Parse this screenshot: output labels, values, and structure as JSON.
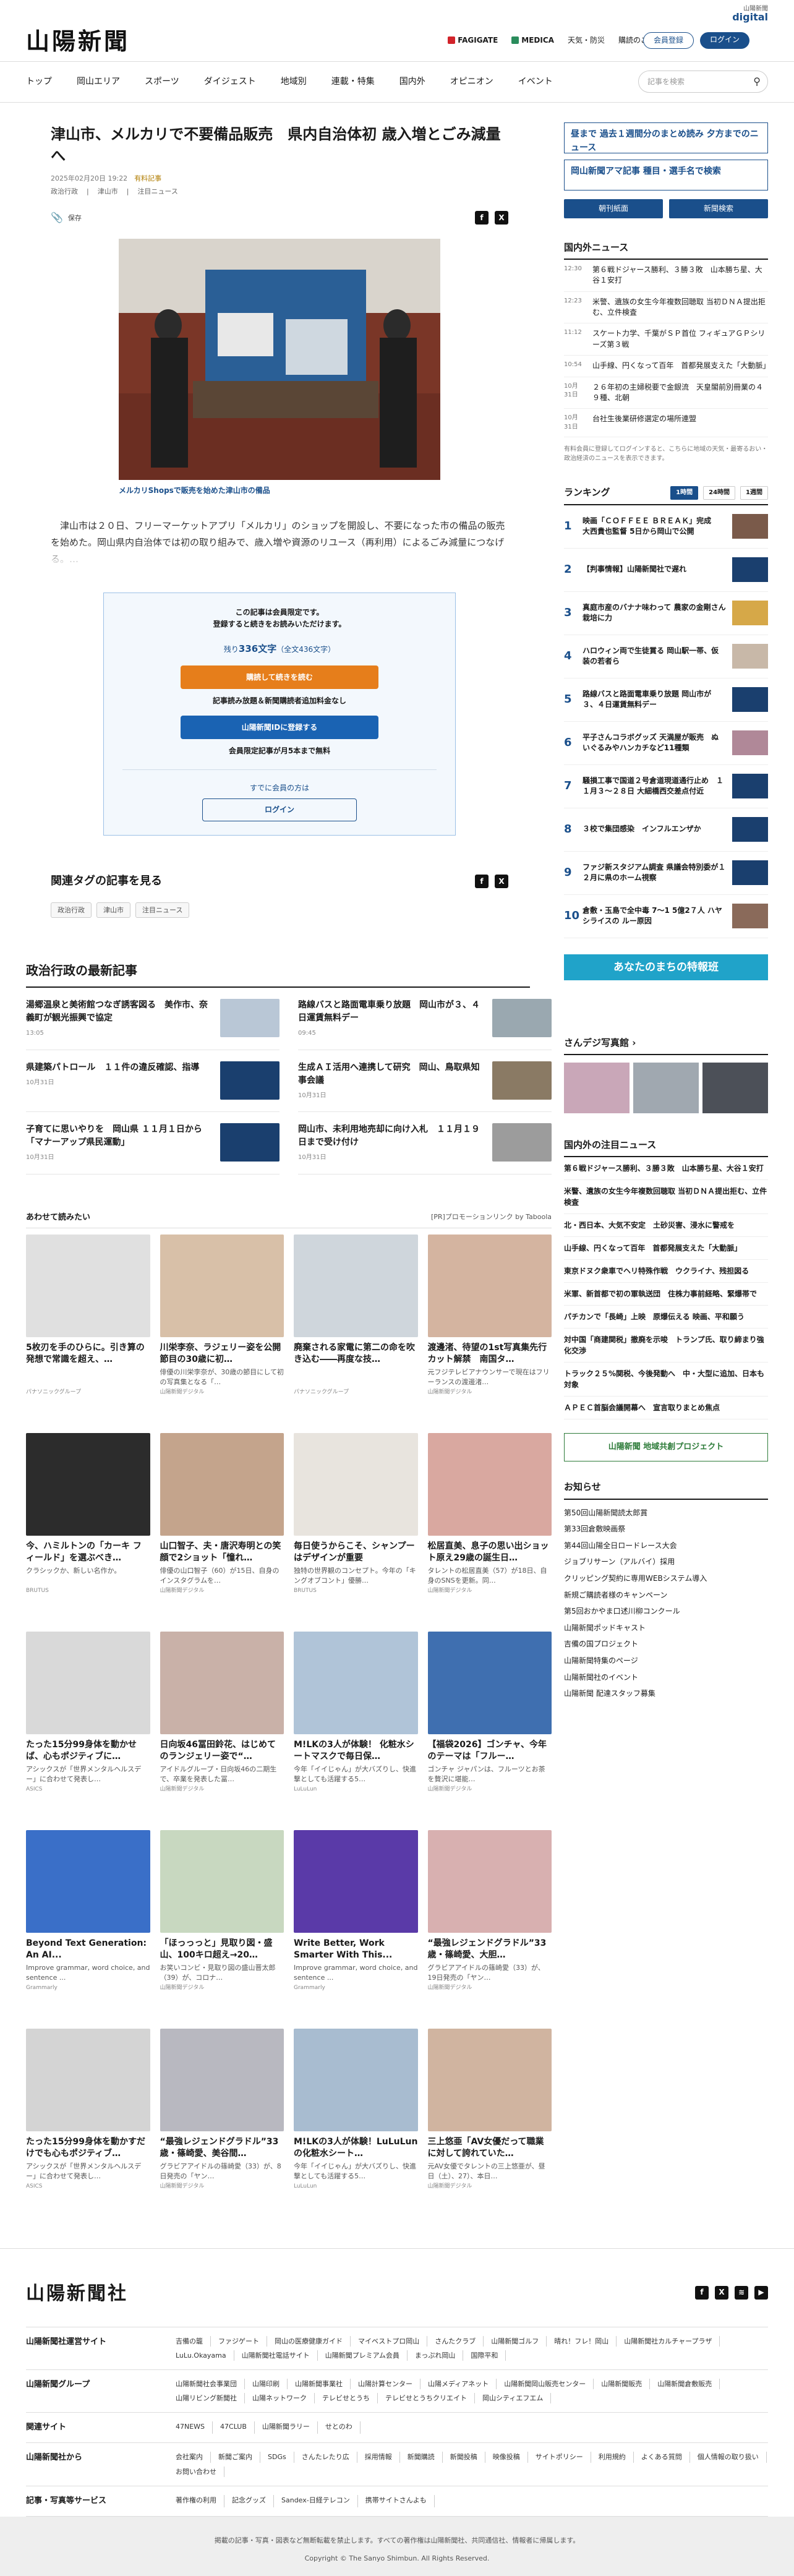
{
  "header": {
    "logo": "山陽新聞",
    "links": [
      "FAGIGATE",
      "MEDICA",
      "天気・防災",
      "購読のご案内"
    ],
    "login": "会員登録",
    "signup": "ログイン",
    "digital": "digital",
    "digital_sub": "山陽新聞"
  },
  "nav": {
    "items": [
      "トップ",
      "岡山エリア",
      "スポーツ",
      "ダイジェスト",
      "地域別",
      "連載・特集",
      "国内外",
      "オピニオン",
      "イベント"
    ],
    "search_placeholder": "記事を検索"
  },
  "article": {
    "title": "津山市、メルカリで不要備品販売　県内自治体初 歳入増とごみ減量へ",
    "date": "2025年02月20日 19:22",
    "updated": "有料記事",
    "crumbs": [
      "政治行政",
      "津山市",
      "注目ニュース"
    ],
    "save": "保存",
    "caption": "メルカリShopsで販売を始めた津山市の備品",
    "lead": "　津山市は２０日、フリーマーケットアプリ「メルカリ」のショップを開設し、不要になった市の備品の販売を始めた。岡山県内自治体では初の取り組みで、歳入増や資源のリユース（再利用）によるごみ減量につなげる。…"
  },
  "paywall": {
    "line1": "この記事は会員限定です。",
    "line2": "登録すると続きをお読みいただけます。",
    "count_pre": "残り",
    "count": "336文字",
    "count_post": "（全文436文字）",
    "btn1": "購読して続きを読む",
    "note1": "記事読み放題＆新聞購読者追加料金なし",
    "btn2": "山陽新聞IDに登録する",
    "note2": "会員限定記事が月5本まで無料",
    "member": "すでに会員の方は",
    "login": "ログイン"
  },
  "related": {
    "title": "関連タグの記事を見る",
    "tags": [
      "政治行政",
      "津山市",
      "注目ニュース"
    ]
  },
  "politics": {
    "title": "政治行政の最新記事",
    "items": [
      {
        "t": "湯郷温泉と美術館つなぎ誘客図る　美作市、奈義町が観光振興で協定",
        "d": "13:05"
      },
      {
        "t": "路線バスと路面電車乗り放題　岡山市が３、４日運賃無料デー",
        "d": "09:45"
      },
      {
        "t": "県建築パトロール　１１件の違反確認、指導",
        "d": "10月31日"
      },
      {
        "t": "生成ＡＩ活用へ連携して研究　岡山、鳥取県知事会議",
        "d": "10月31日"
      },
      {
        "t": "子育てに思いやりを　岡山県 １１月１日から「マナーアップ県民運動」",
        "d": "10月31日"
      },
      {
        "t": "岡山市、未利用地売却に向け入札　１１月１９日まで受け付け",
        "d": "10月31日"
      }
    ]
  },
  "ads": {
    "title": "あわせて読みたい",
    "promo": "[PR]プロモーションリンク by Taboola",
    "items": [
      {
        "t": "5枚刃を手のひらに。引き算の発想で常識を超え、…",
        "s": "",
        "src": "パナソニックグループ"
      },
      {
        "t": "川栄李奈、ラジェリー姿を公開　節目の30歳に初…",
        "s": "俳優の川栄李奈が、30歳の節目にして初の写真集となる「…",
        "src": "山陽新聞デジタル"
      },
      {
        "t": "廃棄される家電に第二の命を吹き込む――再度な技…",
        "s": "",
        "src": "パナソニックグループ"
      },
      {
        "t": "渡邊渚、待望の1st写真集先行カット解禁　南国タ…",
        "s": "元フジテレビアナウンサーで現在はフリーランスの渡邊渚…",
        "src": "山陽新聞デジタル"
      },
      {
        "t": "今、ハミルトンの「カーキ フィールド」を選ぶべき…",
        "s": "クラシックか、新しい名作か。",
        "src": "BRUTUS"
      },
      {
        "t": "山口智子、夫・唐沢寿明との笑顔で2ショット「憧れ…",
        "s": "俳優の山口智子（60）が15日、自身のインスタグラムを…",
        "src": "山陽新聞デジタル"
      },
      {
        "t": "毎日使うからこそ、シャンプーはデザインが重要",
        "s": "独特の世界観のコンセプト。今年の「キングオブコント」優勝…",
        "src": "BRUTUS"
      },
      {
        "t": "松居直美、息子の思い出ショット原え29歳の誕生日…",
        "s": "タレントの松居直美（57）が18日、自身のSNSを更新。同…",
        "src": "山陽新聞デジタル"
      },
      {
        "t": "たった15分99身体を動かせば、心もポジティブに…",
        "s": "アシックスが「世界メンタルヘルスデー」に合わせて発表し…",
        "src": "ASICS"
      },
      {
        "t": "日向坂46冨田鈴花、はじめてのランジェリー姿で“…",
        "s": "アイドルグループ・日向坂46の二期生で、卒業を発表した冨…",
        "src": "山陽新聞デジタル"
      },
      {
        "t": "M!LKの3人が体験！ 化粧水シートマスクで毎日保…",
        "s": "今年「イイじゃん」が大バズりし、快進撃としても活躍する5…",
        "src": "LuLuLun"
      },
      {
        "t": "【福袋2026】ゴンチャ、今年のテーマは「フルー…",
        "s": "ゴンチャ ジャパンは、フルーツとお茶を贅沢に堪能…",
        "src": "山陽新聞デジタル"
      },
      {
        "t": "Beyond Text Generation: An AI...",
        "s": "Improve grammar, word choice, and sentence ...",
        "src": "Grammarly"
      },
      {
        "t": "「ほっっっと」見取り図・盛山、100キロ超え→20…",
        "s": "お笑いコンビ・見取り図の盛山晋太郎（39）が、コロナ…",
        "src": "山陽新聞デジタル"
      },
      {
        "t": "Write Better, Work Smarter With This...",
        "s": "Improve grammar, word choice, and sentence ...",
        "src": "Grammarly"
      },
      {
        "t": "“最強レジェンドグラドル”33歳・篠崎愛、大胆…",
        "s": "グラビアアイドルの篠崎愛（33）が、19日発売の「ヤン…",
        "src": "山陽新聞デジタル"
      },
      {
        "t": "たった15分99身体を動かすだけでも心もポジティブ…",
        "s": "アシックスが「世界メンタルヘルスデー」に合わせて発表し…",
        "src": "ASICS"
      },
      {
        "t": "“最強レジェンドグラドル”33歳・篠崎愛、美谷間…",
        "s": "グラビアアイドルの篠崎愛（33）が、8日発売の「ヤン…",
        "src": "山陽新聞デジタル"
      },
      {
        "t": "M!LKの3人が体験！LuLuLunの化粧水シート…",
        "s": "今年「イイじゃん」が大バズりし、快進撃としても活躍する5…",
        "src": "LuLuLun"
      },
      {
        "t": "三上悠亜「AV女優だって職業に対して誇れていた…",
        "s": "元AV女優でタレントの三上悠亜が、昼日（土）、27）、本日…",
        "src": "山陽新聞デジタル"
      }
    ]
  },
  "side": {
    "banner1": "昼まで 過去１週間分のまとめ読み 夕方までのニュース",
    "banner2": "岡山新聞アマ記事 種目・選手名で検索",
    "btn1": "朝刊紙面",
    "btn2": "新聞検索",
    "domestic_title": "国内外ニュース",
    "domestic": [
      {
        "tm": "12:30",
        "t": "第６戦ドジャース勝利、３勝３敗　山本勝ち星、大谷１安打"
      },
      {
        "tm": "12:23",
        "t": "米警、遺族の女生今年複数回聴取 当初ＤＮＡ提出拒む、立件検査"
      },
      {
        "tm": "11:12",
        "t": "スケート力学、千葉がＳＰ首位 フィギュアＧＰシリーズ第３戦"
      },
      {
        "tm": "10:54",
        "t": "山手線、円くなって百年　首都発展支えた「大動脈」"
      },
      {
        "tm": "10月31日",
        "t": "２６年初の主婦税要で金銀流　天皇閣前別冊業の４９種、北朝"
      },
      {
        "tm": "10月31日",
        "t": "台社生後業研修選定の場所連盟"
      }
    ],
    "note": "有料会員に登録してログインすると、こちらに地域の天気・最寄るおい・政治経済のニュースを表示できます。",
    "ranking_title": "ランキング",
    "rank_tabs": [
      "1時間",
      "24時間",
      "1週間"
    ],
    "ranking": [
      {
        "n": "1",
        "t": "映画「ＣＯＦＦＥＥ ＢＲＥＡＫ」完成　大西貴也監督 5日から岡山で公開"
      },
      {
        "n": "2",
        "t": "【判事情報】山陽新聞社で遅れ"
      },
      {
        "n": "3",
        "t": "真庭市産のバナナ味わって 農家の金剛さん栽培に力"
      },
      {
        "n": "4",
        "t": "ハロウィン両で生徒賞る 岡山駅一帯、仮装の若者ら"
      },
      {
        "n": "5",
        "t": "路線バスと路面電車乗り放題 岡山市が３、４日運賃無料デー"
      },
      {
        "n": "6",
        "t": "平子さんコラボグッズ 天満屋が販売　ぬいぐるみやハンカチなど11種類"
      },
      {
        "n": "7",
        "t": "騒損工事で国道２号倉道現道通行止め　１１月３〜２８日 大細橋西交差点付近"
      },
      {
        "n": "8",
        "t": "３校で集団感染　インフルエンザか"
      },
      {
        "n": "9",
        "t": "ファジ新スタジアム調査 県議会特別委が１２月に県のホーム視察"
      },
      {
        "n": "10",
        "t": "倉敷・玉島で全中毒 7〜1 5億2７人 ハヤシライスの ルー原因"
      }
    ],
    "info": "あなたのまちの特報班",
    "photo_title": "さんデジ写真館",
    "notable_title": "国内外の注目ニュース",
    "notable": [
      "第６戦ドジャース勝利、３勝３敗　山本勝ち星、大谷１安打",
      "米警、遺族の女生今年複数回聴取 当初ＤＮＡ提出拒む、立件検査",
      "北・西日本、大気不安定　土砂災害、浸水に警戒を",
      "山手線、円くなって百年　首都発展支えた「大動脈」",
      "東京ドヌク衆車でヘリ特殊作戦　ウクライナ、残担図る",
      "米軍、新首都で初の軍執送団　住株力事前経略、緊爆帯で",
      "パチカンで「長崎」上映　原爆伝える 映画、平和願う",
      "対中国「商建関税」撤廃を示唆　トランプ氏、取り締まり強化交渉",
      "トラック２５%関税、今後発動へ　中・大型に追加、日本も対象",
      "ＡＰＥＣ首脳会議開幕へ　宣言取りまとめ焦点"
    ],
    "ad_banner": "山陽新聞 地域共創プロジェクト",
    "notice_title": "お知らせ",
    "notices": [
      "第50回山陽新聞読太郎賞",
      "第33回倉敷映画祭",
      "第44回山陽全日ロードレース大会",
      "ジョブリサーン（アルバイ）採用",
      "クリッピング契約に専用WEBシステム導入",
      "新規ご購読者様のキャンペーン",
      "第5回おかやま口述川柳コンクール",
      "山陽新聞ポッドキャスト",
      "吉備の国プロジェクト",
      "山陽新聞特集のページ",
      "山陽新聞社のイベント",
      "山陽新聞 配達スタッフ募集"
    ]
  },
  "footer": {
    "logo": "山陽新聞社",
    "rows": [
      {
        "lb": "山陽新聞社運営サイト",
        "links": [
          "吉備の籠",
          "ファジゲート",
          "岡山の医療健康ガイド",
          "マイベストプロ岡山",
          "さんたクラブ",
          "山陽新聞ゴルフ",
          "晴れ！フレ！岡山",
          "山陽新聞社カルチャープラザ",
          "LuLu.Okayama",
          "山陽新聞社電話サイト",
          "山陽新聞プレミアム会員",
          "まっぷれ岡山",
          "国際平和"
        ]
      },
      {
        "lb": "山陽新聞グループ",
        "links": [
          "山陽新聞社会事業団",
          "山陽印刷",
          "山陽新聞事業社",
          "山陽計算センター",
          "山陽メディアネット",
          "山陽新聞岡山販売センター",
          "山陽新聞販売",
          "山陽新聞倉敷販売",
          "山陽リビング新聞社",
          "山陽ネットワーク",
          "テレビせとうち",
          "テレビせとうちクリエイト",
          "岡山シティエフエム"
        ]
      },
      {
        "lb": "関連サイト",
        "links": [
          "47NEWS",
          "47CLUB",
          "山陽新聞ラリー",
          "せとのわ"
        ]
      },
      {
        "lb": "山陽新聞社から",
        "links": [
          "会社案内",
          "新聞ご案内",
          "SDGs",
          "さんたレたり広",
          "採用情報",
          "新聞購読",
          "新聞投稿",
          "映像投稿",
          "サイトポリシー",
          "利用規約",
          "よくある質問",
          "個人情報の取り扱い",
          "お問い合わせ"
        ]
      },
      {
        "lb": "記事・写真等サービス",
        "links": [
          "著作権の利用",
          "記念グッズ",
          "Sandex-日経テレコン",
          "携帯サイトさんよも"
        ]
      }
    ],
    "disclaimer": "掲載の記事・写真・図表など無断転載を禁止します。すべての著作権は山陽新聞社、共同通信社、情報者に帰属します。",
    "copy": "Copyright © The Sanyo Shimbun. All Rights Reserved."
  }
}
